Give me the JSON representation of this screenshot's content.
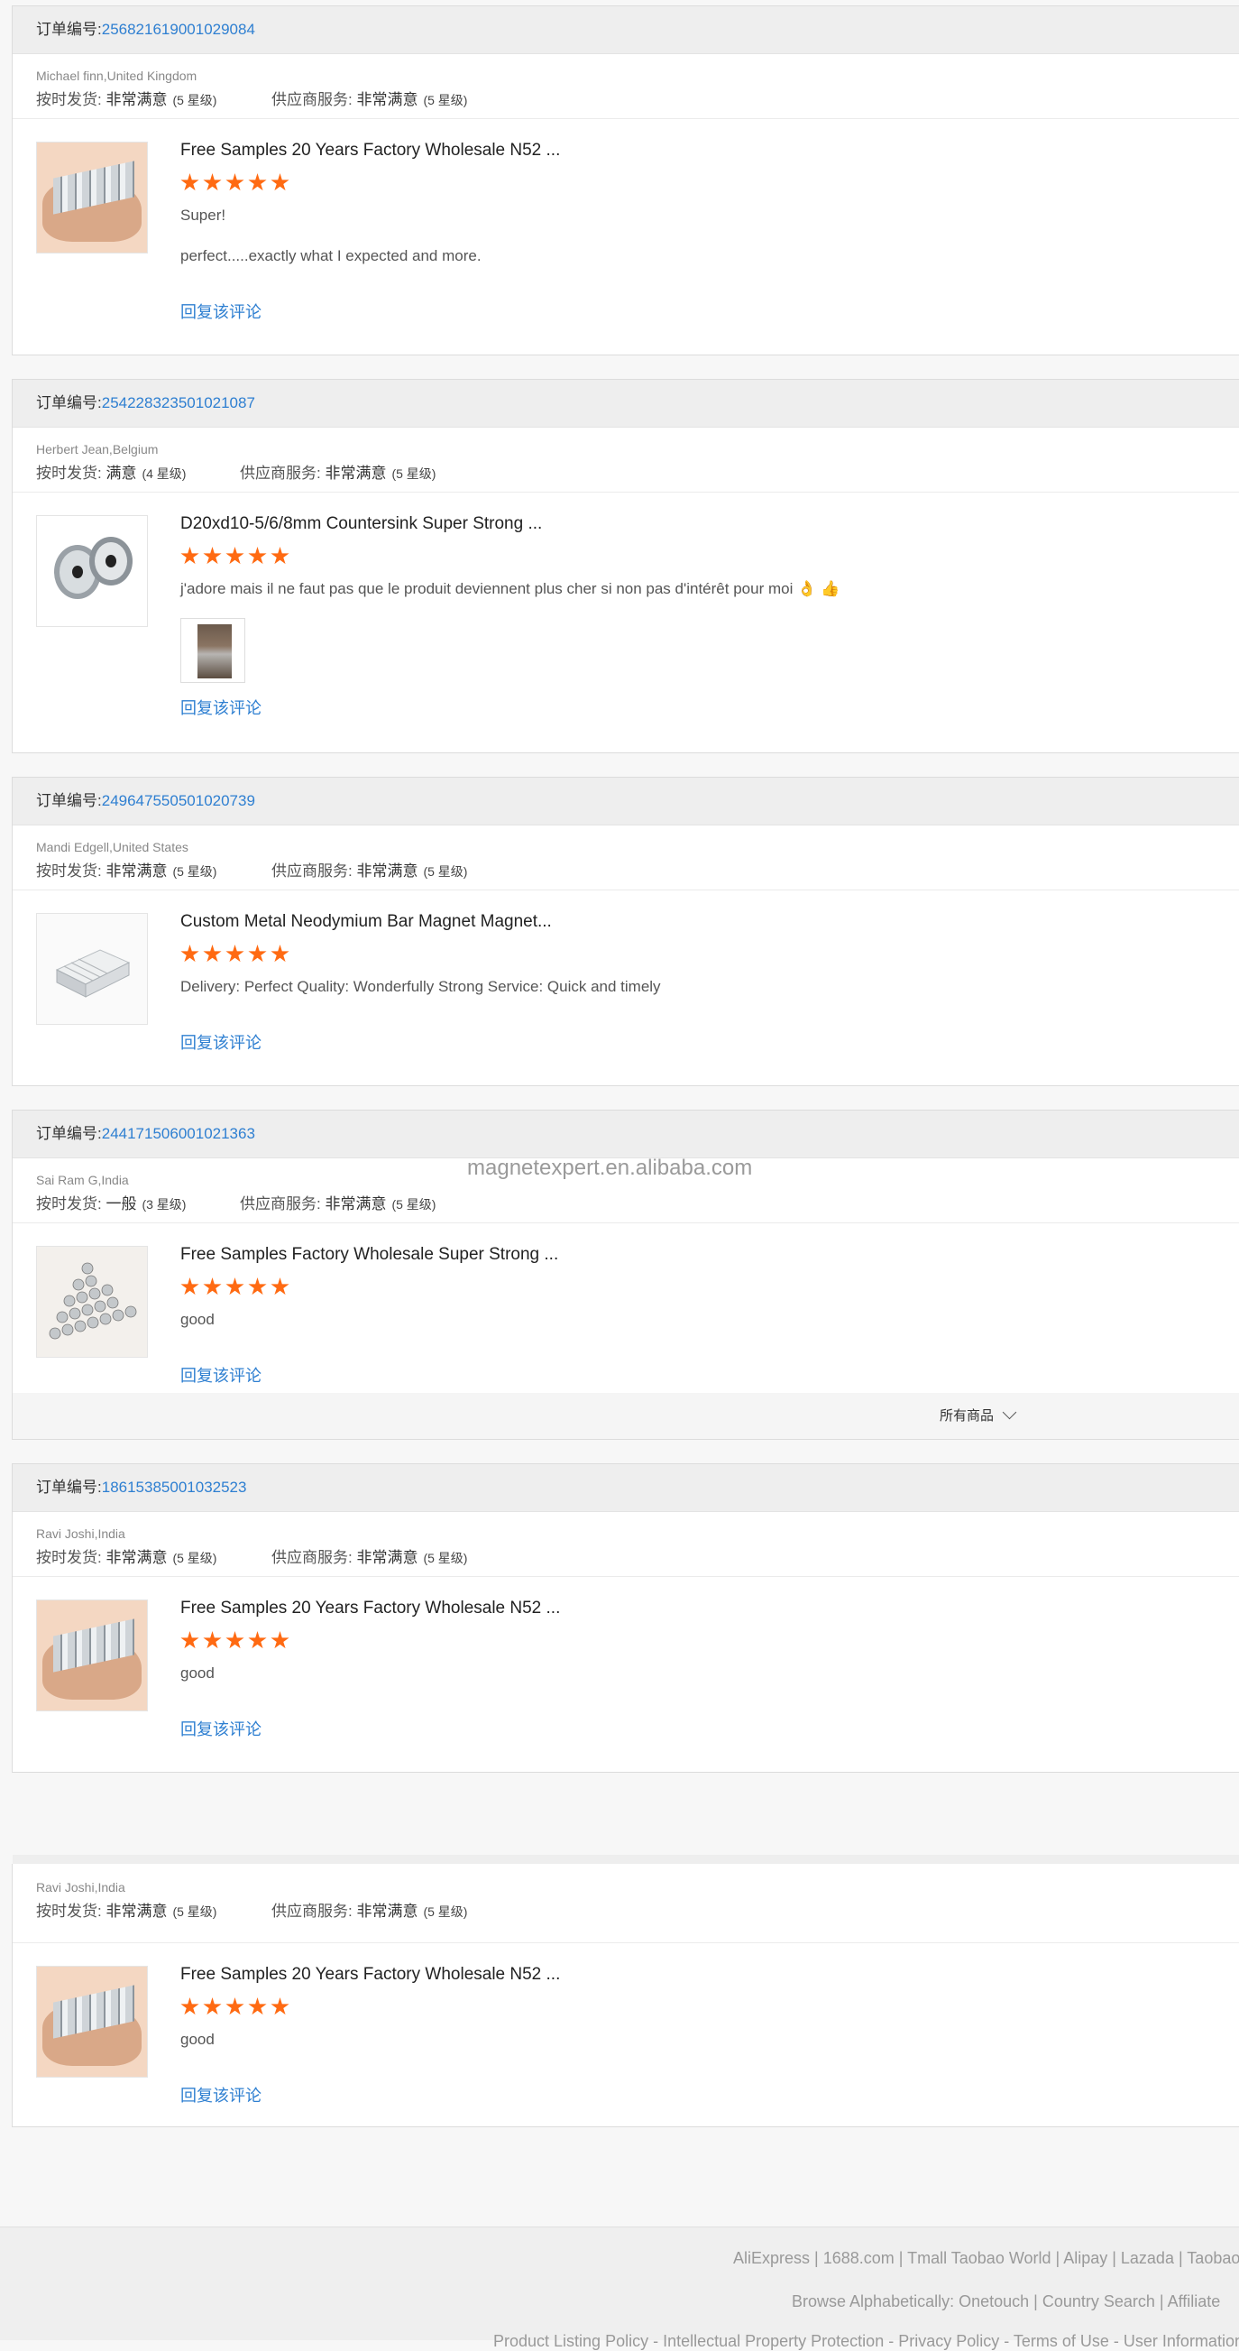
{
  "reviews": [
    {
      "order_label": "订单编号:",
      "order_no": "256821619001029084",
      "buyer": "Michael finn,United Kingdom",
      "ship_label": "按时发货:",
      "ship_value": "非常满意",
      "ship_level": "(5 星级)",
      "service_label": "供应商服务:",
      "service_value": "非常满意",
      "service_level": "(5 星级)",
      "product_title": "Free Samples 20 Years Factory Wholesale N52 ...",
      "stars": 5,
      "text1": "Super!",
      "text2": "perfect.....exactly what I expected and more.",
      "reply": "回复该评论"
    },
    {
      "order_label": "订单编号:",
      "order_no": "254228323501021087",
      "buyer": "Herbert Jean,Belgium",
      "ship_label": "按时发货:",
      "ship_value": "满意",
      "ship_level": "(4 星级)",
      "service_label": "供应商服务:",
      "service_value": "非常满意",
      "service_level": "(5 星级)",
      "product_title": "D20xd10-5/6/8mm Countersink Super Strong ...",
      "stars": 5,
      "text1": "j'adore mais il ne faut pas que le produit deviennent plus cher si non pas d'intérêt pour moi 👌 👍",
      "reply": "回复该评论"
    },
    {
      "order_label": "订单编号:",
      "order_no": "249647550501020739",
      "buyer": "Mandi Edgell,United States",
      "ship_label": "按时发货:",
      "ship_value": "非常满意",
      "ship_level": "(5 星级)",
      "service_label": "供应商服务:",
      "service_value": "非常满意",
      "service_level": "(5 星级)",
      "product_title": "Custom Metal Neodymium Bar Magnet Magnet...",
      "stars": 5,
      "text1": "Delivery:   Perfect Quality:   Wonderfully Strong Service:   Quick and timely",
      "reply": "回复该评论"
    },
    {
      "order_label": "订单编号:",
      "order_no": "244171506001021363",
      "buyer": "Sai Ram G,India",
      "ship_label": "按时发货:",
      "ship_value": "一般",
      "ship_level": "(3 星级)",
      "service_label": "供应商服务:",
      "service_value": "非常满意",
      "service_level": "(5 星级)",
      "product_title": "Free Samples Factory Wholesale Super Strong ...",
      "stars": 5,
      "text1": "good",
      "reply": "回复该评论"
    },
    {
      "order_label": "订单编号:",
      "order_no": "186153850010325​23",
      "buyer": "Ravi Joshi,India",
      "ship_label": "按时发货:",
      "ship_value": "非常满意",
      "ship_level": "(5 星级)",
      "service_label": "供应商服务:",
      "service_value": "非常满意",
      "service_level": "(5 星级)",
      "product_title": "Free Samples 20 Years Factory Wholesale N52 ...",
      "stars": 5,
      "text1": "good",
      "reply": "回复该评论"
    },
    {
      "buyer": "Ravi Joshi,India",
      "ship_label": "按时发货:",
      "ship_value": "非常满意",
      "ship_level": "(5 星级)",
      "service_label": "供应商服务:",
      "service_value": "非常满意",
      "service_level": "(5 星级)",
      "product_title": "Free Samples 20 Years Factory Wholesale N52 ...",
      "stars": 5,
      "text1": "good",
      "reply": "回复该评论"
    }
  ],
  "watermark": "magnetexpert.en.alibaba.com",
  "all_products": "所有商品",
  "footer": {
    "line1": "AliExpress | 1688.com | Tmall Taobao World | Alipay | Lazada | Taobao Glo",
    "line2": "Browse Alphabetically: Onetouch | Country Search | Affiliate",
    "line3": "Product Listing Policy - Intellectual Property Protection - Privacy Policy - Terms of Use - User Information Lega"
  },
  "colors": {
    "accent": "#2e7fd1",
    "star": "#ff6a12"
  }
}
